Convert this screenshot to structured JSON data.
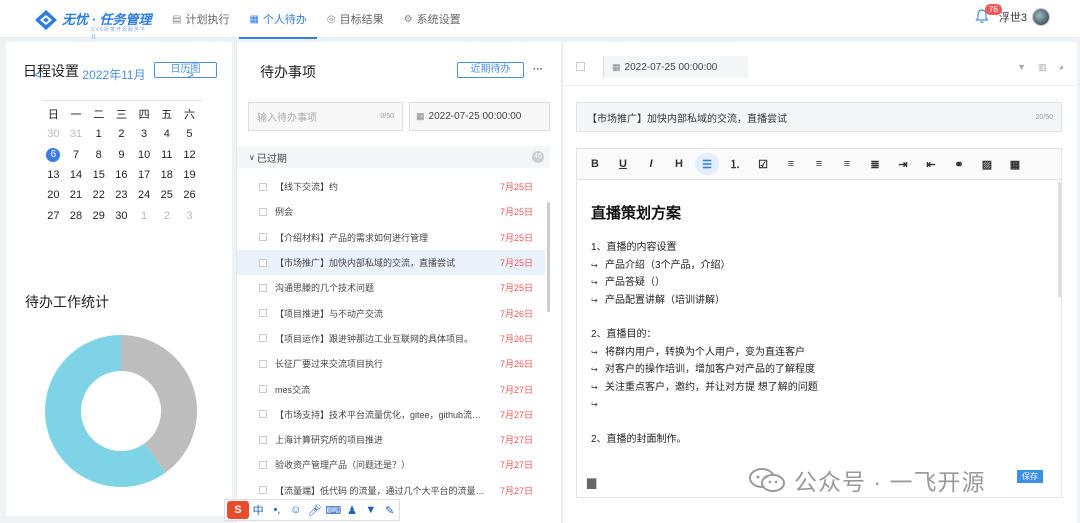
{
  "brand": {
    "name": "无忧 · 任务管理",
    "sub": "SVS研发开源服务平台"
  },
  "nav": [
    {
      "label": "计划执行",
      "icon": "plan-icon"
    },
    {
      "label": "个人待办",
      "icon": "calendar-icon"
    },
    {
      "label": "目标结果",
      "icon": "target-icon"
    },
    {
      "label": "系统设置",
      "icon": "gear-icon"
    }
  ],
  "user": {
    "name": "浮世3",
    "badge": "76"
  },
  "schedule": {
    "title": "日程设置",
    "button": "日历图",
    "month": "2022年11月",
    "weekdays": [
      "日",
      "一",
      "二",
      "三",
      "四",
      "五",
      "六"
    ],
    "weeks": [
      [
        "30",
        "31",
        "1",
        "2",
        "3",
        "4",
        "5"
      ],
      [
        "6",
        "7",
        "8",
        "9",
        "10",
        "11",
        "12"
      ],
      [
        "13",
        "14",
        "15",
        "16",
        "17",
        "18",
        "19"
      ],
      [
        "20",
        "21",
        "22",
        "23",
        "24",
        "25",
        "26"
      ],
      [
        "27",
        "28",
        "29",
        "30",
        "1",
        "2",
        "3"
      ]
    ],
    "today": "6"
  },
  "stats": {
    "title": "待办工作统计",
    "segments": [
      {
        "value": 0.4,
        "color": "#bdbdbd"
      },
      {
        "value": 0.6,
        "color": "#7fd3e6"
      }
    ]
  },
  "todo": {
    "title": "待办事项",
    "button": "近期待办",
    "more": "···",
    "input_placeholder": "输入待办事项",
    "input_count": "0/50",
    "date": "2022-07-25 00:00:00",
    "group": "已过期",
    "group_count": "46",
    "items": [
      {
        "text": "【线下交流】约",
        "date": "7月25日"
      },
      {
        "text": "例会",
        "date": "7月25日"
      },
      {
        "text": "【介绍材料】产品的需求如何进行管理",
        "date": "7月25日"
      },
      {
        "text": "【市场推广】加快内部私域的交流，直播尝试",
        "date": "7月25日"
      },
      {
        "text": "沟通思滕的几个技术问题",
        "date": "7月25日"
      },
      {
        "text": "【项目推进】与不动产交流",
        "date": "7月26日"
      },
      {
        "text": "【项目运作】跟进钟那边工业互联网的具体项目。",
        "date": "7月26日"
      },
      {
        "text": "长征厂要过来交流项目执行",
        "date": "7月26日"
      },
      {
        "text": "mes交流",
        "date": "7月27日"
      },
      {
        "text": "【市场支持】技术平台流量优化，gitee，github流量运作",
        "date": "7月27日"
      },
      {
        "text": "上海计算研究所的项目推进",
        "date": "7月27日"
      },
      {
        "text": "验收资产管理产品（问题还是？）",
        "date": "7月27日"
      },
      {
        "text": "【流量端】低代码 的流量，通过几个大平台的流量获取",
        "date": "7月27日"
      }
    ]
  },
  "editor": {
    "date": "2022-07-25 00:00:00",
    "title": "【市场推广】加快内部私域的交流，直播尝试",
    "title_count": "20/50",
    "toolbar": [
      "B",
      "U",
      "I",
      "H",
      "list-bullet-icon",
      "list-number-icon",
      "list-check-icon",
      "align-left-icon",
      "align-center-icon",
      "align-right-icon",
      "align-justify-icon",
      "indent-icon",
      "outdent-icon",
      "link-icon",
      "image-icon",
      "table-icon"
    ],
    "doc": {
      "heading": "直播策划方案",
      "s1": "1、直播的内容设置",
      "l1": [
        "产品介绍（3个产品，介绍）",
        "产品答疑（）",
        "产品配置讲解（培训讲解）"
      ],
      "s2": "2、直播目的：",
      "l2": [
        "将群内用户，转换为个人用户，变为直连客户",
        "对客户的操作培训，增加客户对产品的了解程度",
        "关注重点客户，邀约，并让对方提 想了解的问题",
        ""
      ],
      "s3": "2、直播的封面制作。"
    },
    "save": "保存"
  },
  "watermark": "公众号 · 一飞开源"
}
